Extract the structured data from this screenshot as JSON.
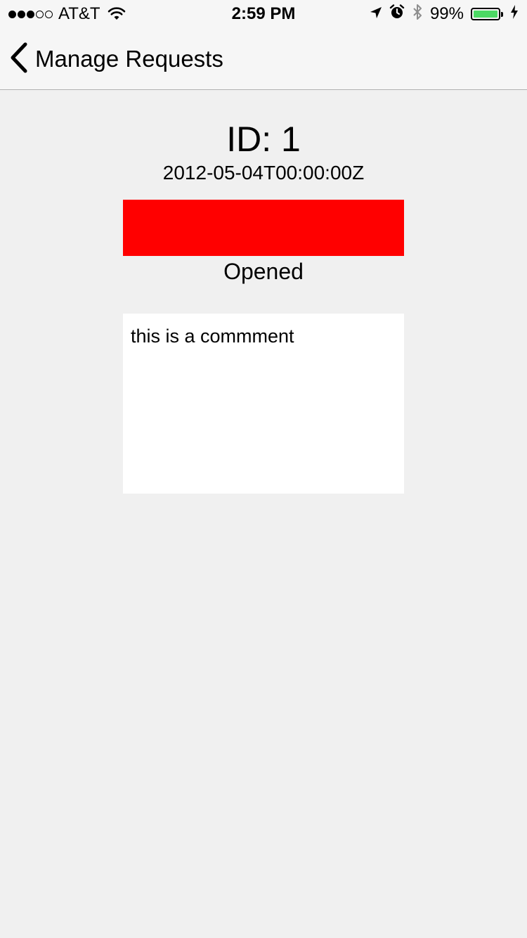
{
  "status_bar": {
    "signal_bars_filled": 3,
    "signal_bars_total": 5,
    "carrier": "AT&T",
    "time": "2:59 PM",
    "battery_percent_label": "99%",
    "battery_level": 0.99,
    "icons": [
      "wifi-icon",
      "location-arrow-icon",
      "alarm-icon",
      "bluetooth-icon",
      "battery-icon",
      "charging-bolt-icon"
    ]
  },
  "nav": {
    "back_label": "Manage Requests",
    "back_icon": "chevron-left-icon"
  },
  "request": {
    "id_label": "ID: 1",
    "date": "2012-05-04T00:00:00Z",
    "status_color": "#ff0000",
    "status": "Opened",
    "comment": "this is a commment"
  },
  "colors": {
    "background": "#f0f0f0",
    "nav_background": "#f6f6f6",
    "battery_fill": "#4cd964",
    "status_red": "#ff0000"
  }
}
